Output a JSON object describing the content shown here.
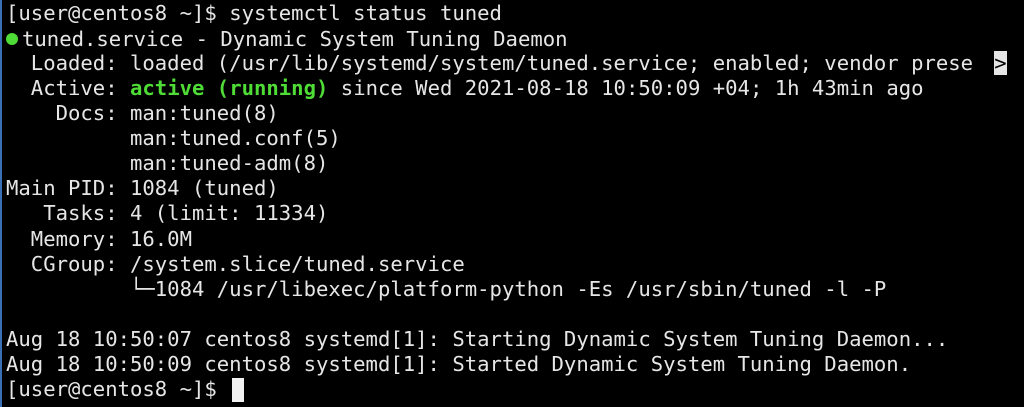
{
  "prompt": "[user@centos8 ~]$",
  "command": "systemctl status tuned",
  "service_title": "tuned.service - Dynamic System Tuning Daemon",
  "status_fields": {
    "loaded": "  Loaded: loaded (/usr/lib/systemd/system/tuned.service; enabled; vendor prese",
    "active_label": "  Active: ",
    "active_state": "active (running)",
    "active_since": " since Wed 2021-08-18 10:50:09 +04; 1h 43min ago",
    "docs_1": "    Docs: man:tuned(8)",
    "docs_2": "          man:tuned.conf(5)",
    "docs_3": "          man:tuned-adm(8)",
    "main_pid": "Main PID: 1084 (tuned)",
    "tasks": "   Tasks: 4 (limit: 11334)",
    "memory": "  Memory: 16.0M",
    "cgroup": "  CGroup: /system.slice/tuned.service",
    "cgroup_proc": "          └─1084 /usr/libexec/platform-python -Es /usr/sbin/tuned -l -P"
  },
  "truncation_marker": ">",
  "journal": [
    "Aug 18 10:50:07 centos8 systemd[1]: Starting Dynamic System Tuning Daemon...",
    "Aug 18 10:50:09 centos8 systemd[1]: Started Dynamic System Tuning Daemon."
  ],
  "final_prompt": "[user@centos8 ~]$ ",
  "colors": {
    "background": "#000000",
    "foreground": "#e6e6e6",
    "status_green": "#4fdc36",
    "window_border": "#3b6fb5"
  },
  "icons": {
    "status_dot": "green-status-dot-icon"
  }
}
